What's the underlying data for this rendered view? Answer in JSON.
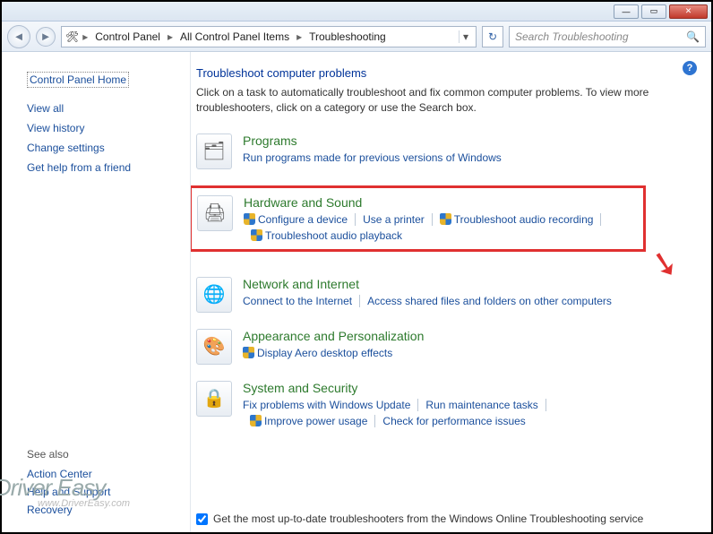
{
  "window": {
    "min": "—",
    "max": "▭",
    "close": "✕"
  },
  "breadcrumb": {
    "root_icon": "🛠",
    "items": [
      "Control Panel",
      "All Control Panel Items",
      "Troubleshooting"
    ]
  },
  "search": {
    "placeholder": "Search Troubleshooting"
  },
  "sidebar": {
    "home": "Control Panel Home",
    "items": [
      "View all",
      "View history",
      "Change settings",
      "Get help from a friend"
    ],
    "seealso_label": "See also",
    "seealso": [
      "Action Center",
      "Help and Support",
      "Recovery"
    ]
  },
  "main": {
    "heading": "Troubleshoot computer problems",
    "subtitle": "Click on a task to automatically troubleshoot and fix common computer problems. To view more troubleshooters, click on a category or use the Search box."
  },
  "categories": [
    {
      "title": "Programs",
      "links": [
        {
          "text": "Run programs made for previous versions of Windows",
          "shield": false
        }
      ]
    },
    {
      "title": "Hardware and Sound",
      "highlighted": true,
      "links": [
        {
          "text": "Configure a device",
          "shield": true
        },
        {
          "text": "Use a printer",
          "shield": false
        },
        {
          "text": "Troubleshoot audio recording",
          "shield": true
        },
        {
          "text": "Troubleshoot audio playback",
          "shield": true
        }
      ]
    },
    {
      "title": "Network and Internet",
      "links": [
        {
          "text": "Connect to the Internet",
          "shield": false
        },
        {
          "text": "Access shared files and folders on other computers",
          "shield": false
        }
      ]
    },
    {
      "title": "Appearance and Personalization",
      "links": [
        {
          "text": "Display Aero desktop effects",
          "shield": true
        }
      ]
    },
    {
      "title": "System and Security",
      "links": [
        {
          "text": "Fix problems with Windows Update",
          "shield": false
        },
        {
          "text": "Run maintenance tasks",
          "shield": false
        },
        {
          "text": "Improve power usage",
          "shield": true
        },
        {
          "text": "Check for performance issues",
          "shield": false
        }
      ]
    }
  ],
  "footer": {
    "checkbox_checked": true,
    "label": "Get the most up-to-date troubleshooters from the Windows Online Troubleshooting service"
  },
  "watermark": {
    "line1": "Driver Easy",
    "line2": "www.DriverEasy.com"
  }
}
